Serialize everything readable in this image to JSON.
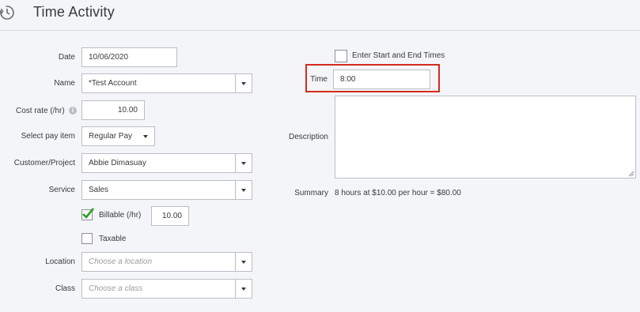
{
  "header": {
    "title": "Time Activity",
    "icon": "clock-history-icon"
  },
  "form": {
    "date": {
      "label": "Date",
      "value": "10/06/2020"
    },
    "name": {
      "label": "Name",
      "value": "*Test Account"
    },
    "cost_rate": {
      "label": "Cost rate (/hr)",
      "value": "10.00",
      "info_icon": "info-icon"
    },
    "pay_item": {
      "label": "Select pay item",
      "value": "Regular Pay"
    },
    "customer": {
      "label": "Customer/Project",
      "value": "Abbie Dimasuay"
    },
    "service": {
      "label": "Service",
      "value": "Sales"
    },
    "billable": {
      "label": "Billable (/hr)",
      "checked": true,
      "value": "10.00"
    },
    "taxable": {
      "label": "Taxable",
      "checked": false
    },
    "location": {
      "label": "Location",
      "placeholder": "Choose a location"
    },
    "class": {
      "label": "Class",
      "placeholder": "Choose a class"
    }
  },
  "right": {
    "start_end": {
      "label": "Enter Start and End Times",
      "checked": false
    },
    "time": {
      "label": "Time",
      "value": "8:00"
    },
    "description": {
      "label": "Description",
      "value": ""
    },
    "summary": {
      "label": "Summary",
      "value": "8 hours at $10.00 per hour = $80.00"
    }
  },
  "colors": {
    "highlight": "#d52b1e",
    "check": "#2ca01c",
    "border": "#babec5"
  }
}
